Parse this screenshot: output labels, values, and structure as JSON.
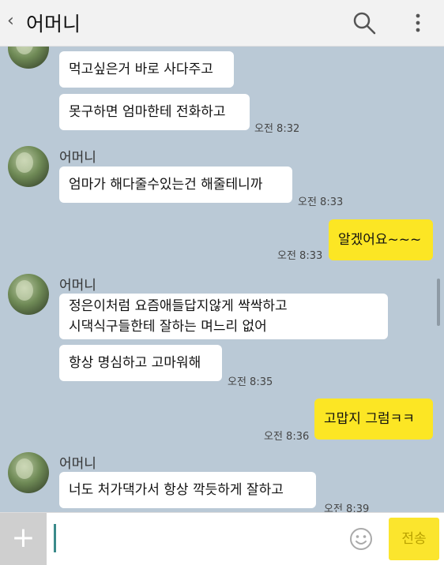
{
  "header": {
    "back": "‹",
    "title": "어머니"
  },
  "contact": {
    "name": "어머니"
  },
  "messages": [
    {
      "text": "먹고싶은거 바로 사다주고"
    },
    {
      "text": "못구하면 엄마한테 전화하고",
      "time": "오전 8:32"
    },
    {
      "text": "엄마가 해다줄수있는건 해줄테니까",
      "time": "오전 8:33"
    },
    {
      "text": "알겠어요~~~",
      "time": "오전 8:33"
    },
    {
      "line1": "정은이처럼 요즘애들답지않게 싹싹하고",
      "line2": "시댁식구들한테 잘하는 며느리 없어"
    },
    {
      "text": "항상 명심하고 고마워해",
      "time": "오전 8:35"
    },
    {
      "text": "고맙지 그럼ㅋㅋ",
      "time": "오전 8:36"
    },
    {
      "text": "너도 처가댁가서 항상 깍듯하게 잘하고",
      "time": "오전 8:39"
    }
  ],
  "input": {
    "plus": "+",
    "send": "전송"
  },
  "colors": {
    "chat_bg": "#bac9d6",
    "my_bubble": "#fce624",
    "their_bubble": "#ffffff",
    "send_button": "#fbe52d"
  }
}
